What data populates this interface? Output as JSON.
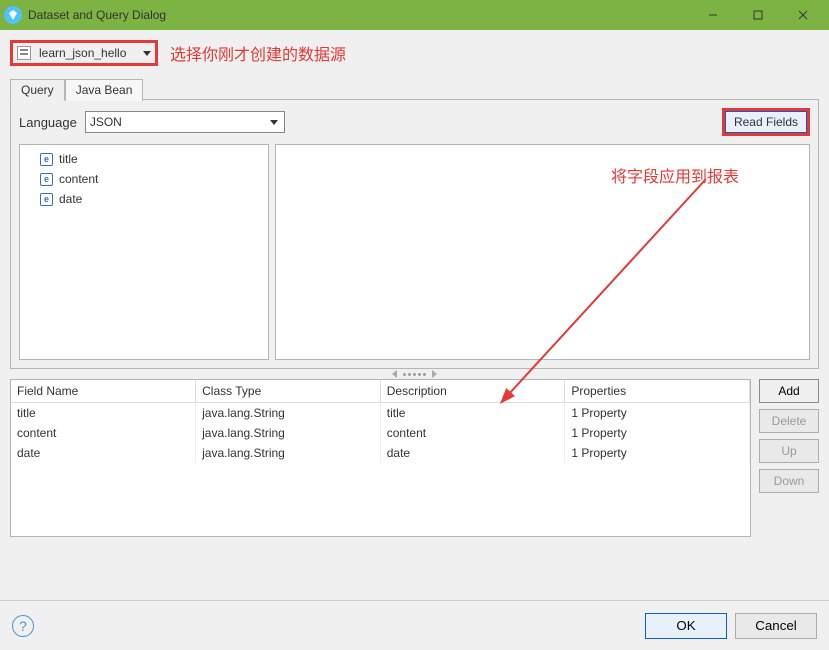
{
  "window": {
    "title": "Dataset and Query Dialog"
  },
  "datasource": {
    "selected": "learn_json_hello",
    "annotation": "选择你刚才创建的数据源"
  },
  "tabs": [
    {
      "label": "Query",
      "active": true
    },
    {
      "label": "Java Bean",
      "active": false
    }
  ],
  "language": {
    "label": "Language",
    "value": "JSON"
  },
  "read_fields": {
    "label": "Read Fields",
    "annotation": "将字段应用到报表"
  },
  "tree": {
    "items": [
      "title",
      "content",
      "date"
    ]
  },
  "grid": {
    "columns": [
      "Field Name",
      "Class Type",
      "Description",
      "Properties"
    ],
    "rows": [
      {
        "name": "title",
        "type": "java.lang.String",
        "desc": "title",
        "props": "1 Property"
      },
      {
        "name": "content",
        "type": "java.lang.String",
        "desc": "content",
        "props": "1 Property"
      },
      {
        "name": "date",
        "type": "java.lang.String",
        "desc": "date",
        "props": "1 Property"
      }
    ]
  },
  "side_buttons": {
    "add": "Add",
    "delete": "Delete",
    "up": "Up",
    "down": "Down"
  },
  "footer": {
    "ok": "OK",
    "cancel": "Cancel"
  }
}
